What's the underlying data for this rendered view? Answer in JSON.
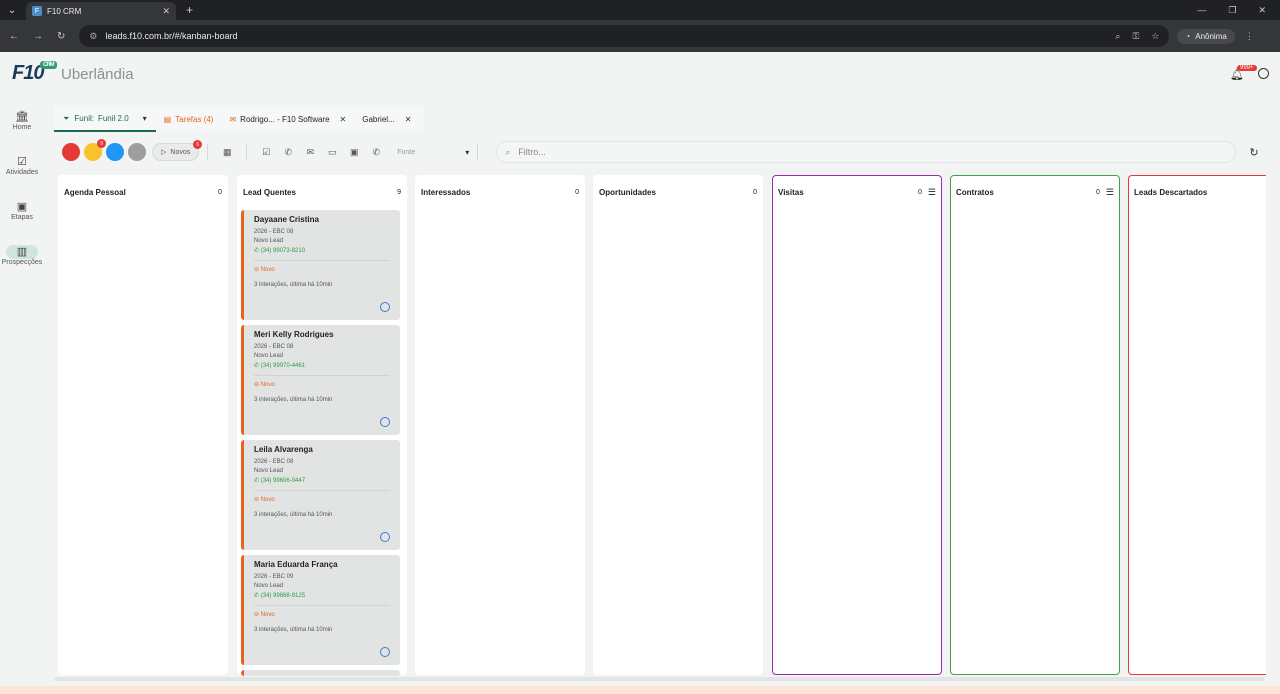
{
  "browser": {
    "tab_title": "F10 CRM",
    "url": "leads.f10.com.br/#/kanban-board",
    "profile_label": "Anônima"
  },
  "header": {
    "logo_text": "F10",
    "logo_badge": "CRM",
    "city": "Uberlândia",
    "notifications_badge": "999+"
  },
  "sidebar": {
    "items": [
      {
        "label": "Home"
      },
      {
        "label": "Atividades"
      },
      {
        "label": "Etapas"
      },
      {
        "label": "Prospecções"
      }
    ]
  },
  "tabs": {
    "funil_label": "Funil:",
    "funil_value": "Funil 2.0",
    "tarefas_label": "Tarefas (4)",
    "rodrigo_label": "Rodrigo... - F10 Software",
    "gabriel_label": "Gabriel..."
  },
  "actions": {
    "dots": [
      {
        "color": "#e53935",
        "badge": ""
      },
      {
        "color": "#fbc02d",
        "badge": "9"
      },
      {
        "color": "#2196f3",
        "badge": ""
      },
      {
        "color": "#9e9e9e",
        "badge": ""
      }
    ],
    "novos_label": "Novos",
    "novos_badge": "6",
    "fonte_placeholder": "Fonte",
    "filtro_placeholder": "Filtro..."
  },
  "columns": [
    {
      "title": "Agenda Pessoal",
      "count": "0",
      "border": "",
      "filter": false
    },
    {
      "title": "Lead Quentes",
      "count": "9",
      "border": "",
      "filter": false
    },
    {
      "title": "Interessados",
      "count": "0",
      "border": "",
      "filter": false
    },
    {
      "title": "Oportunidades",
      "count": "0",
      "border": "",
      "filter": false
    },
    {
      "title": "Visitas",
      "count": "0",
      "border": "#9c27b0",
      "filter": true
    },
    {
      "title": "Contratos",
      "count": "0",
      "border": "#43a047",
      "filter": true
    },
    {
      "title": "Leads Descartados",
      "count": "",
      "border": "#e53935",
      "filter": false
    }
  ],
  "cards": [
    {
      "name": "Dayaane Cristina",
      "course": "2026 - EBC 08",
      "stage": "Novo Lead",
      "phone": "(34) 99073-8210",
      "status": "Novo",
      "interactions": "3 interações, última há 10min"
    },
    {
      "name": "Meri Kelly Rodrigues",
      "course": "2026 - EBC 08",
      "stage": "Novo Lead",
      "phone": "(34) 99970-4461",
      "status": "Novo",
      "interactions": "3 interações, última há 10min"
    },
    {
      "name": "Leila Alvarenga",
      "course": "2026 - EBC 08",
      "stage": "Novo Lead",
      "phone": "(34) 99606-0447",
      "status": "Novo",
      "interactions": "3 interações, última há 10min"
    },
    {
      "name": "Maria Eduarda França",
      "course": "2026 - EBC 09",
      "stage": "Novo Lead",
      "phone": "(34) 99868-9125",
      "status": "Novo",
      "interactions": "3 interações, última há 10min"
    }
  ]
}
